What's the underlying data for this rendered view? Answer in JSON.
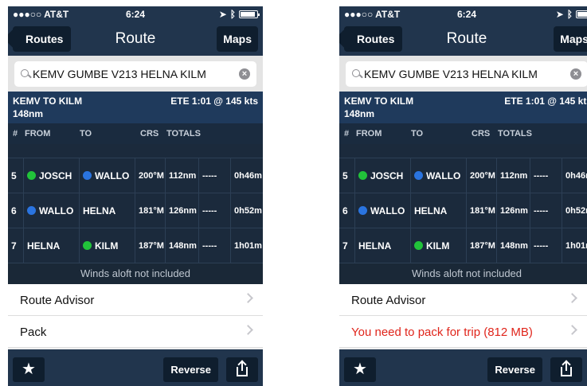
{
  "status": {
    "carrier": "●●●○○ AT&T",
    "time": "6:24"
  },
  "nav": {
    "back_label": "Routes",
    "title": "Route",
    "maps_label": "Maps"
  },
  "search": {
    "value": "KEMV GUMBE V213 HELNA KILM",
    "clear_glyph": "×"
  },
  "summary": {
    "route": "KEMV TO KILM",
    "distance": "148nm",
    "ete": "ETE 1:01 @ 145 kts"
  },
  "table": {
    "headers": {
      "num": "#",
      "from": "FROM",
      "to": "TO",
      "crs": "CRS",
      "totals": "TOTALS"
    },
    "rows": [
      {
        "num": "5",
        "from": "JOSCH",
        "from_dot": "green",
        "to": "WALLO",
        "to_dot": "blue",
        "crs": "200°M",
        "dist": "112nm",
        "fuel": "-----",
        "time": "0h46m"
      },
      {
        "num": "6",
        "from": "WALLO",
        "from_dot": "blue",
        "to": "HELNA",
        "to_dot": "",
        "crs": "181°M",
        "dist": "126nm",
        "fuel": "-----",
        "time": "0h52m"
      },
      {
        "num": "7",
        "from": "HELNA",
        "from_dot": "",
        "to": "KILM",
        "to_dot": "green",
        "crs": "187°M",
        "dist": "148nm",
        "fuel": "-----",
        "time": "1h01m"
      }
    ]
  },
  "winds_note": "Winds aloft not included",
  "left_list": {
    "advisor": "Route Advisor",
    "pack": "Pack"
  },
  "right_list": {
    "advisor": "Route Advisor",
    "pack": "You need to pack for trip (812 MB)"
  },
  "toolbar": {
    "star": "★",
    "reverse": "Reverse"
  },
  "colors": {
    "navy": "#21354d",
    "button": "#0f1e2e",
    "warning": "#e0251b",
    "green_dot": "#21c33a",
    "blue_dot": "#2a74e0"
  }
}
